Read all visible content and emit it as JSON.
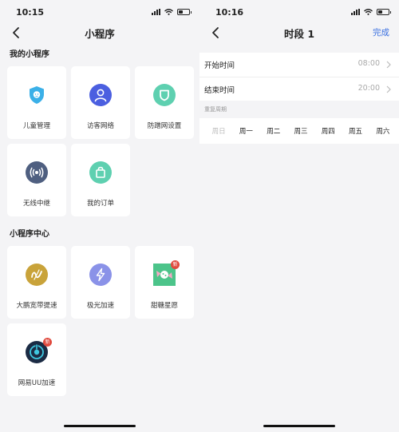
{
  "left": {
    "status_time": "10:15",
    "title": "小程序",
    "my_section": "我的小程序",
    "my_apps": [
      {
        "label": "儿童管理"
      },
      {
        "label": "访客网络"
      },
      {
        "label": "防蹭网设置"
      },
      {
        "label": "无线中继"
      },
      {
        "label": "我的订单"
      }
    ],
    "center_section": "小程序中心",
    "center_apps": [
      {
        "label": "大鹏宽带提速"
      },
      {
        "label": "极光加速"
      },
      {
        "label": "甜糖星愿",
        "badge": "新"
      },
      {
        "label": "网易UU加速",
        "badge": "新"
      }
    ]
  },
  "right": {
    "status_time": "10:16",
    "title": "时段 1",
    "done_label": "完成",
    "start_label": "开始时间",
    "start_value": "08:00",
    "end_label": "结束时间",
    "end_value": "20:00",
    "repeat_label": "重复周期",
    "days": [
      {
        "label": "周日",
        "selected": false
      },
      {
        "label": "周一",
        "selected": true
      },
      {
        "label": "周二",
        "selected": true
      },
      {
        "label": "周三",
        "selected": true
      },
      {
        "label": "周四",
        "selected": true
      },
      {
        "label": "周五",
        "selected": true
      },
      {
        "label": "周六",
        "selected": true
      }
    ]
  },
  "colors": {
    "accent": "#3a6fe0",
    "child_icon": "#3bb0e8",
    "guest_icon": "#4b5fe0",
    "guard_icon": "#5ed0b0",
    "repeater_icon": "#4f5f80",
    "orders_icon": "#5ed0b0",
    "dapeng_icon": "#c9a33a",
    "jiguang_icon": "#8a92e8",
    "tiantang_icon": "#4cc48a",
    "uu_icon": "#1b2b44",
    "badge": "#e04a3e"
  },
  "icons": {
    "child": "child-shield-icon",
    "guest": "person-icon",
    "guard": "shield-icon",
    "repeater": "wireless-signal-icon",
    "orders": "shopping-bag-icon",
    "dapeng": "dapeng-logo-icon",
    "jiguang": "lightning-icon",
    "tiantang": "candy-icon",
    "uu": "uu-power-icon"
  }
}
